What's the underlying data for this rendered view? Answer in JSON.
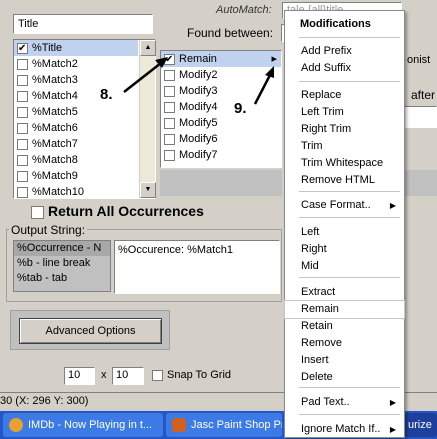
{
  "title_field": "Title",
  "automatch_label": "AutoMatch:",
  "automatch_value": "tale.{all}title",
  "found_between_label": "Found between:",
  "list": [
    "%Title",
    "%Match2",
    "%Match3",
    "%Match4",
    "%Match5",
    "%Match6",
    "%Match7",
    "%Match8",
    "%Match9",
    "%Match10"
  ],
  "modifiers": [
    "Remain",
    "Modify2",
    "Modify3",
    "Modify4",
    "Modify5",
    "Modify6",
    "Modify7"
  ],
  "annotations": {
    "a8": "8.",
    "a9": "9."
  },
  "right_frag": {
    "r1": "onist",
    "r2": "after"
  },
  "return_all": "Return All Occurrences",
  "output_label": "Output String:",
  "output_items": [
    "%Occurrence - N",
    "%b - line break",
    "%tab - tab"
  ],
  "output_value": "%Occurence: %Match1",
  "advanced_btn": "Advanced Options",
  "grid_x": "10",
  "grid_times": "x",
  "grid_y": "10",
  "snap": "Snap To Grid",
  "status": "30 (X: 296  Y: 300)",
  "menu": {
    "header": "Modifications",
    "items": [
      "Add Prefix",
      "Add Suffix",
      "Replace",
      "Left Trim",
      "Right Trim",
      "Trim",
      "Trim Whitespace",
      "Remove HTML",
      "Case Format..",
      "Left",
      "Right",
      "Mid",
      "Extract",
      "Remain",
      "Retain",
      "Remove",
      "Insert",
      "Delete",
      "Pad Text..",
      "Ignore Match If.."
    ]
  },
  "taskbar": [
    "IMDb - Now Playing in t...",
    "Jasc Paint Shop Pr",
    "urize"
  ]
}
